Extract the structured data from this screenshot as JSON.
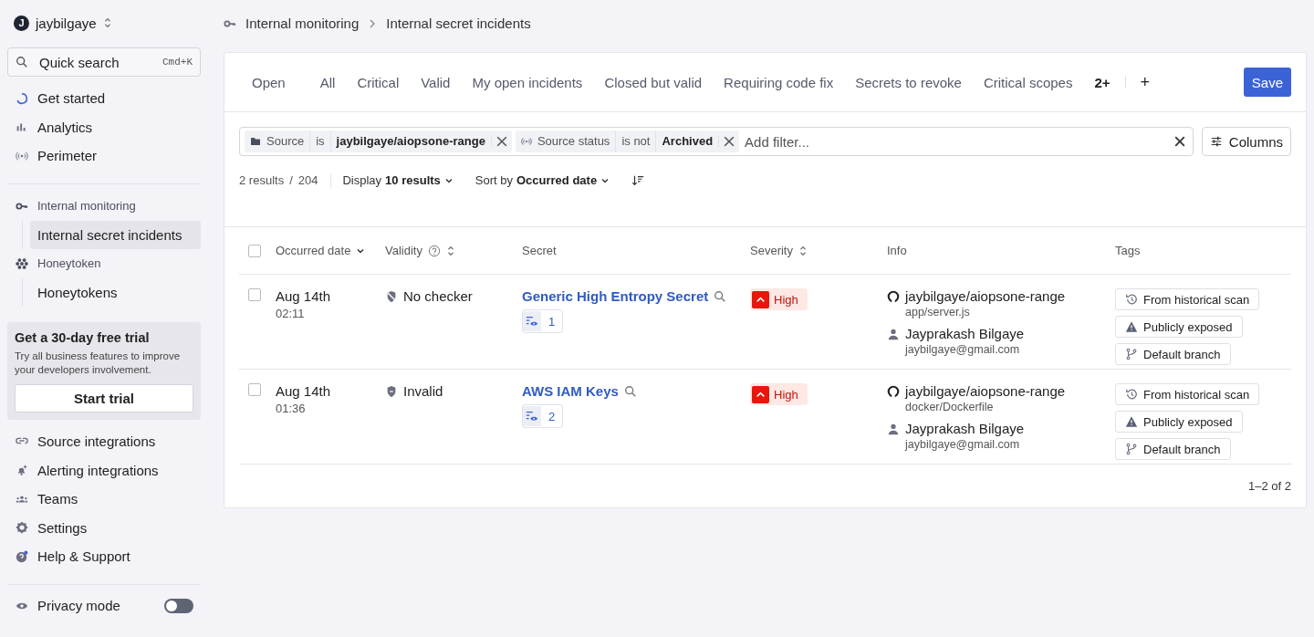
{
  "workspace": {
    "initial": "J",
    "name": "jaybilgaye"
  },
  "quick_search": {
    "placeholder": "Quick search",
    "shortcut": "Cmd+K"
  },
  "nav_top": [
    {
      "label": "Get started"
    },
    {
      "label": "Analytics"
    },
    {
      "label": "Perimeter"
    }
  ],
  "nav_groups": [
    {
      "label": "Internal monitoring",
      "children": [
        {
          "label": "Internal secret incidents",
          "selected": true
        }
      ]
    },
    {
      "label": "Honeytoken",
      "children": [
        {
          "label": "Honeytokens",
          "selected": false
        }
      ]
    }
  ],
  "trial": {
    "title": "Get a 30-day free trial",
    "text": "Try all business features to improve your developers involvement.",
    "button": "Start trial"
  },
  "nav_bottom": [
    {
      "label": "Source integrations"
    },
    {
      "label": "Alerting integrations"
    },
    {
      "label": "Teams"
    },
    {
      "label": "Settings"
    },
    {
      "label": "Help & Support"
    }
  ],
  "privacy": {
    "label": "Privacy mode",
    "on": false
  },
  "breadcrumb": [
    "Internal monitoring",
    "Internal secret incidents"
  ],
  "tabs": [
    {
      "label": "Open",
      "selected": false
    },
    {
      "label": "All",
      "selected": false
    },
    {
      "label": "Critical",
      "selected": false
    },
    {
      "label": "Valid",
      "selected": false
    },
    {
      "label": "My open incidents",
      "selected": false
    },
    {
      "label": "Closed but valid",
      "selected": false
    },
    {
      "label": "Requiring code fix",
      "selected": false
    },
    {
      "label": "Secrets to revoke",
      "selected": false
    },
    {
      "label": "Critical scopes",
      "selected": false
    }
  ],
  "more_tabs": "2+",
  "add_tab": "+",
  "save": "Save",
  "filters": [
    {
      "kind": "source",
      "field": "Source",
      "op": "is",
      "value": "jaybilgaye/aiopsone-range"
    },
    {
      "kind": "status",
      "field": "Source status",
      "op": "is not",
      "value": "Archived"
    }
  ],
  "filter_placeholder": "Add filter...",
  "columns_button": "Columns",
  "summary": {
    "results": "2 results",
    "separator": "/",
    "total": "204",
    "display_label": "Display",
    "display_value": "10 results",
    "sort_label": "Sort by",
    "sort_value": "Occurred date"
  },
  "table": {
    "all_checked": false,
    "columns": [
      "Occurred date",
      "Validity",
      "Secret",
      "Severity",
      "Info",
      "Tags"
    ],
    "rows": [
      {
        "checked": false,
        "date": "Aug 14th",
        "time": "02:11",
        "kind": "no_checker",
        "validity": "No checker",
        "secret": "Generic High Entropy Secret",
        "occurrences": "1",
        "severity": "High",
        "repo": "jaybilgaye/aiopsone-range",
        "path": "app/server.js",
        "person": "Jayprakash Bilgaye",
        "email": "jaybilgaye@gmail.com",
        "tags": [
          {
            "kind": "history",
            "label": "From historical scan"
          },
          {
            "kind": "warning",
            "label": "Publicly exposed"
          },
          {
            "kind": "branch",
            "label": "Default branch"
          }
        ]
      },
      {
        "checked": false,
        "date": "Aug 14th",
        "time": "01:36",
        "kind": "invalid",
        "validity": "Invalid",
        "secret": "AWS IAM Keys",
        "occurrences": "2",
        "severity": "High",
        "repo": "jaybilgaye/aiopsone-range",
        "path": "docker/Dockerfile",
        "person": "Jayprakash Bilgaye",
        "email": "jaybilgaye@gmail.com",
        "tags": [
          {
            "kind": "history",
            "label": "From historical scan"
          },
          {
            "kind": "warning",
            "label": "Publicly exposed"
          },
          {
            "kind": "branch",
            "label": "Default branch"
          }
        ]
      }
    ]
  },
  "pagination": "1–2 of 2"
}
